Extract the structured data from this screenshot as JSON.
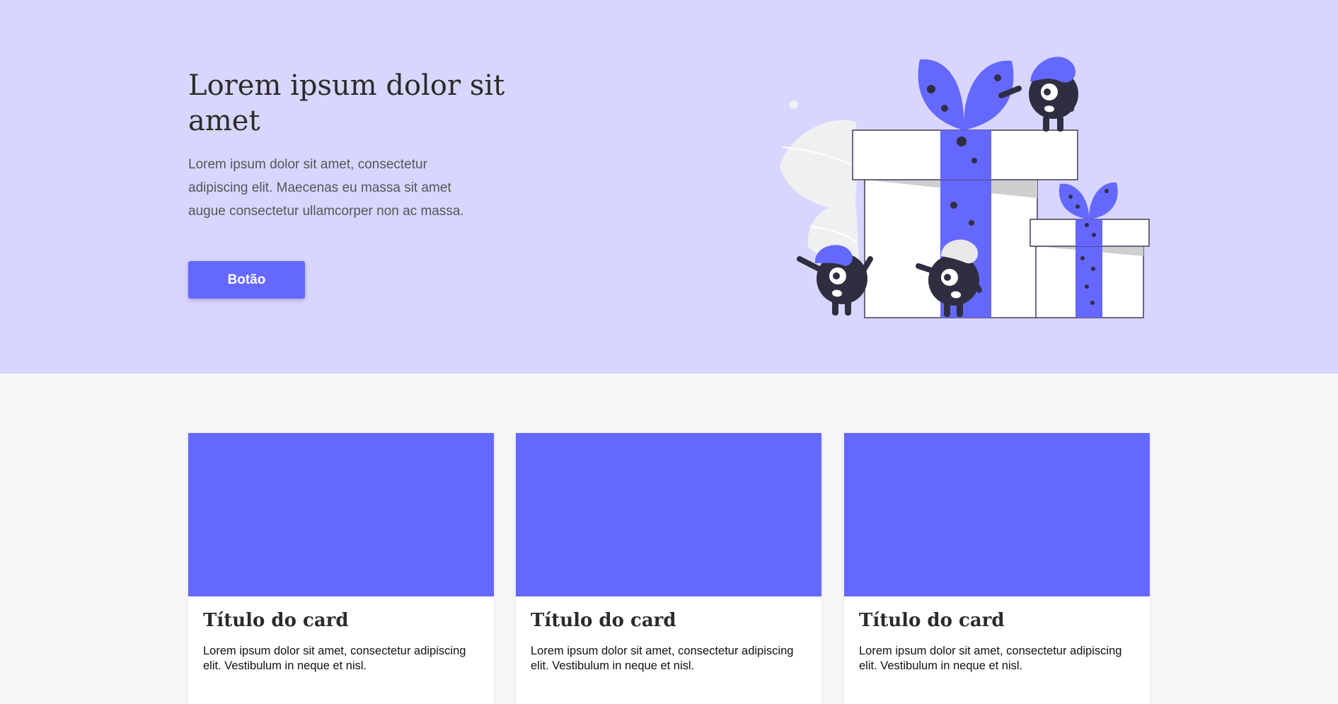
{
  "hero": {
    "title": "Lorem ipsum dolor sit amet",
    "text": "Lorem ipsum dolor sit amet, consectetur adipiscing elit. Maecenas eu massa sit amet augue consectetur ullamcorper non ac massa.",
    "button_label": "Botão",
    "illustration_icon": "gift-boxes-monsters-illustration"
  },
  "cards": [
    {
      "title": "Título do card",
      "text": "Lorem ipsum dolor sit amet, consectetur adipiscing elit. Vestibulum in neque et nisl."
    },
    {
      "title": "Título do card",
      "text": "Lorem ipsum dolor sit amet, consectetur adipiscing elit. Vestibulum in neque et nisl."
    },
    {
      "title": "Título do card",
      "text": "Lorem ipsum dolor sit amet, consectetur adipiscing elit. Vestibulum in neque et nisl."
    }
  ],
  "colors": {
    "hero_background": "#d8d6fe",
    "accent": "#6568fe",
    "page_background": "#f7f7f7",
    "dark": "#2f2e41"
  }
}
